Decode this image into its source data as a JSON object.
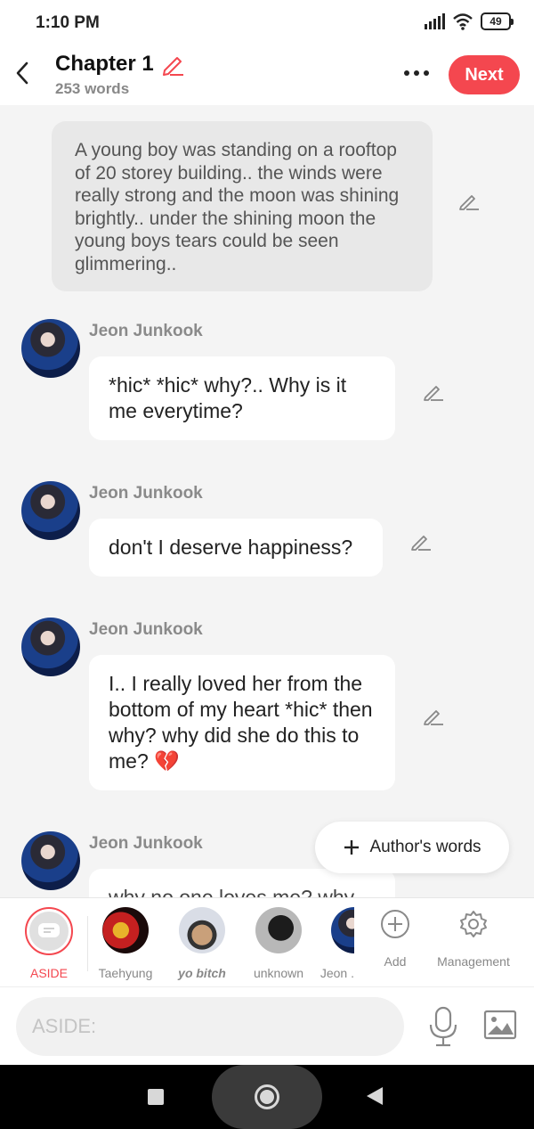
{
  "status_bar": {
    "time": "1:10 PM",
    "battery": "49"
  },
  "header": {
    "title": "Chapter 1",
    "word_count": "253 words",
    "next_label": "Next"
  },
  "narration": {
    "text": "A young boy was standing on a rooftop of 20 storey building.. the winds were really strong and the moon was shining brightly.. under the shining moon the young boys tears could be seen glimmering.."
  },
  "messages": [
    {
      "speaker": "Jeon Junkook",
      "text": "*hic* *hic* why?.. Why is it me everytime?"
    },
    {
      "speaker": "Jeon Junkook",
      "text": "don't I deserve happiness?"
    },
    {
      "speaker": "Jeon Junkook",
      "text": "I.. I really loved her from the bottom of my heart *hic* then why? why did she do this to me? 💔"
    },
    {
      "speaker": "Jeon Junkook",
      "text": "why no one loves me? why..."
    }
  ],
  "authors_words_label": "Author's words",
  "characters": [
    {
      "name": "ASIDE",
      "color": "#f4474f"
    },
    {
      "name": "Taehyung"
    },
    {
      "name": "yo bitch"
    },
    {
      "name": "unknown"
    },
    {
      "name": "Jeon ."
    }
  ],
  "tools": {
    "add_label": "Add",
    "management_label": "Management"
  },
  "input": {
    "placeholder": "ASIDE:"
  },
  "colors": {
    "accent": "#f4474f",
    "bubble": "#ffffff",
    "narration_bg": "#e8e8e8",
    "background": "#f4f4f4"
  }
}
